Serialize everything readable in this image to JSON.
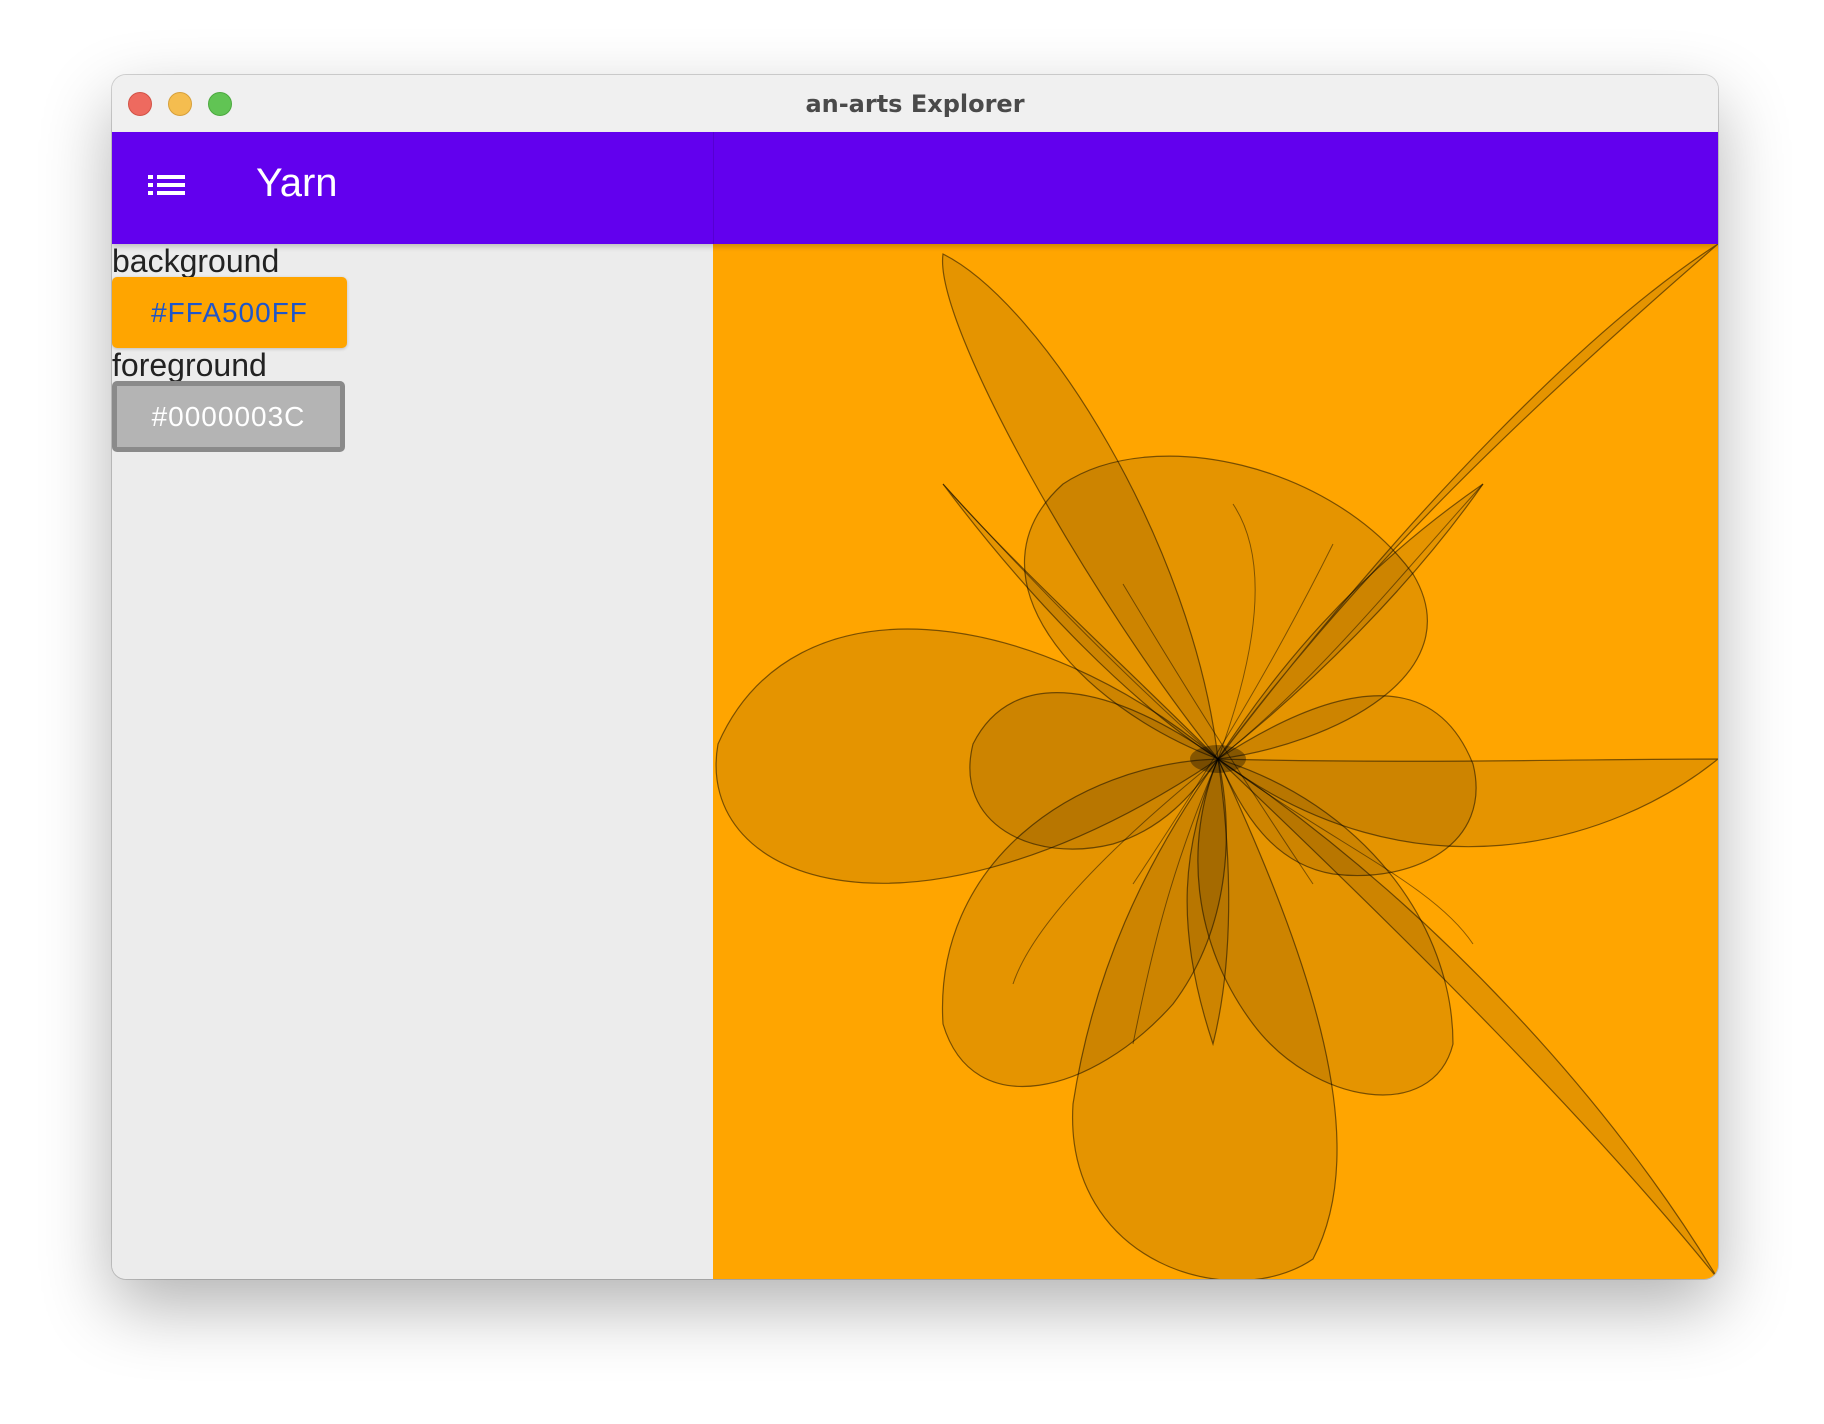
{
  "window": {
    "title": "an-arts Explorer"
  },
  "appbar": {
    "title": "Yarn",
    "color": "#6200ee",
    "menu_icon": "list-icon"
  },
  "settings": {
    "background": {
      "label": "background",
      "value": "#FFA500FF",
      "color": "#FFA500"
    },
    "foreground": {
      "label": "foreground",
      "value": "#0000003C",
      "color": "#000000"
    }
  }
}
